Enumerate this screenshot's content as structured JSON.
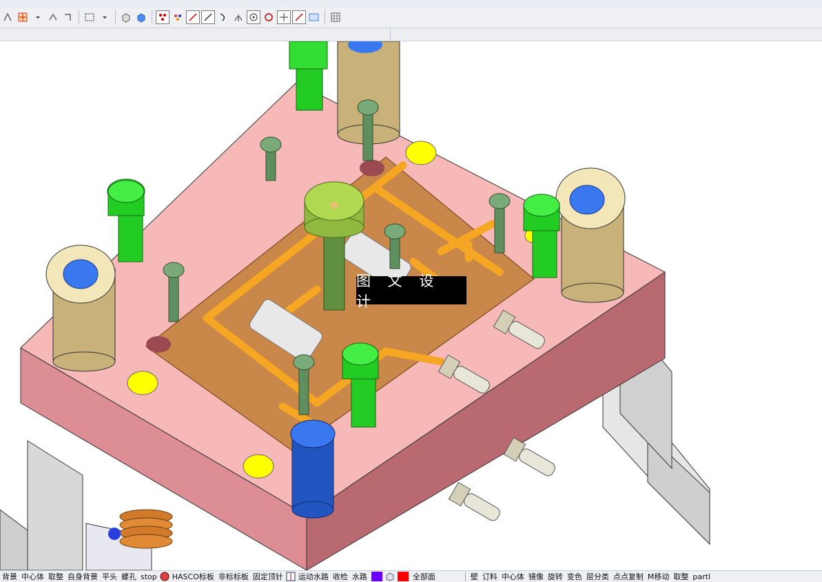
{
  "watermark": {
    "text": "图 文 设 计"
  },
  "bottom_bar": {
    "left_items": [
      "背景",
      "中心体",
      "取整",
      "自身背景",
      "平头",
      "螺孔",
      "stop"
    ],
    "hasco_label": "HASCO标板",
    "mid_items": [
      "非标标板",
      "固定顶针"
    ],
    "water_items": [
      "运动水路",
      "收检",
      "水路"
    ],
    "color_swatch_1": "#6a00ff",
    "color_swatch_2": "#ff0000",
    "hole_label": "全部面",
    "right_items": [
      "壁",
      "订料",
      "中心体",
      "镜像",
      "旋转",
      "变色",
      "层分类",
      "点点复制",
      "M移动",
      "取整",
      "partl"
    ]
  },
  "colors": {
    "plate_top": "#f7b8b8",
    "plate_side_left": "#dc8e94",
    "plate_side_right": "#b86a70",
    "copper": "#c9874a",
    "pipe": "#f5a623",
    "bolt": "#22cc22",
    "screw": "#5f8f5f",
    "bushing": "#d9c69a",
    "blue_cap": "#3a78f0",
    "dark_blue": "#2355c0",
    "yellow": "#ffff00",
    "gray": "#d4d4d4"
  }
}
